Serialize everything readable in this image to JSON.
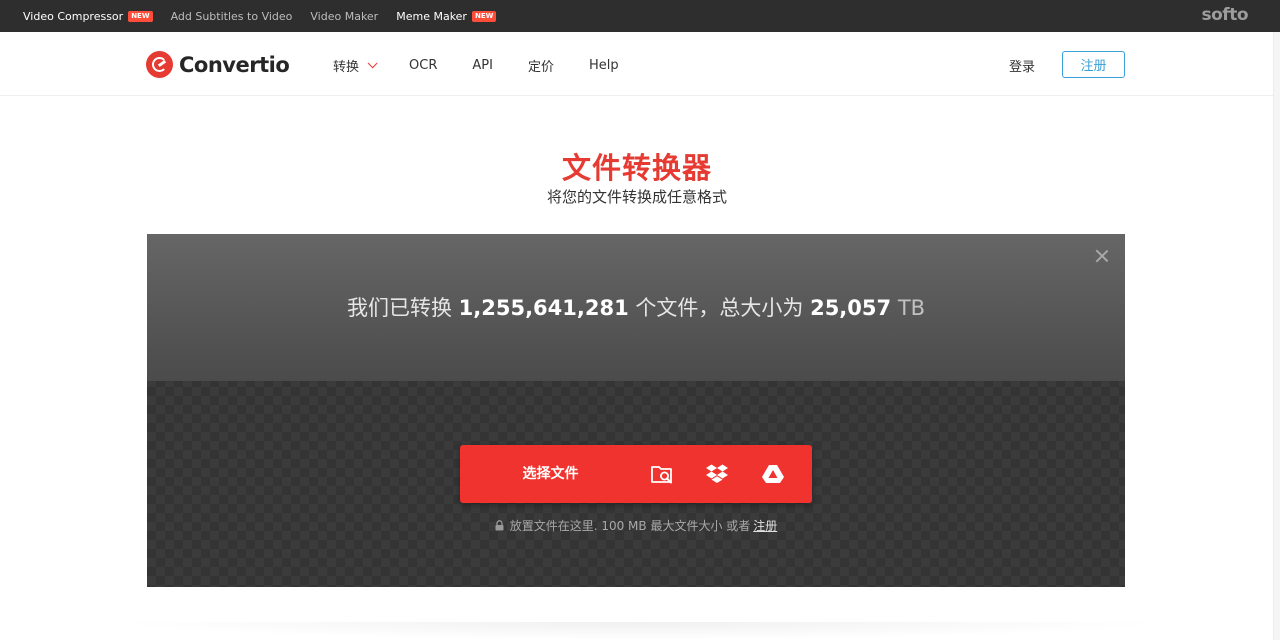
{
  "topbar": {
    "links": [
      {
        "label": "Video Compressor",
        "badge": "NEW"
      },
      {
        "label": "Add Subtitles to Video",
        "badge": ""
      },
      {
        "label": "Video Maker",
        "badge": ""
      },
      {
        "label": "Meme Maker",
        "badge": "NEW"
      }
    ],
    "brand": "softo"
  },
  "nav": {
    "logo_text": "Convertio",
    "menu": [
      "转换",
      "OCR",
      "API",
      "定价",
      "Help"
    ],
    "login": "登录",
    "signup": "注册"
  },
  "hero": {
    "title": "文件转换器",
    "subtitle": "将您的文件转换成任意格式"
  },
  "converter": {
    "stats_prefix": "我们已转换",
    "files_count": "1,255,641,281",
    "stats_middle": "个文件，总大小为",
    "total_size": "25,057",
    "unit": "TB",
    "choose_label": "选择文件",
    "source_icons": [
      "folder-search-icon",
      "dropbox-icon",
      "google-drive-icon"
    ],
    "hint_text": "放置文件在这里. 100 MB 最大文件大小 或者",
    "hint_link": "注册"
  },
  "colors": {
    "accent": "#e63b33",
    "button": "#f0332e",
    "signup": "#3aa0d6"
  }
}
